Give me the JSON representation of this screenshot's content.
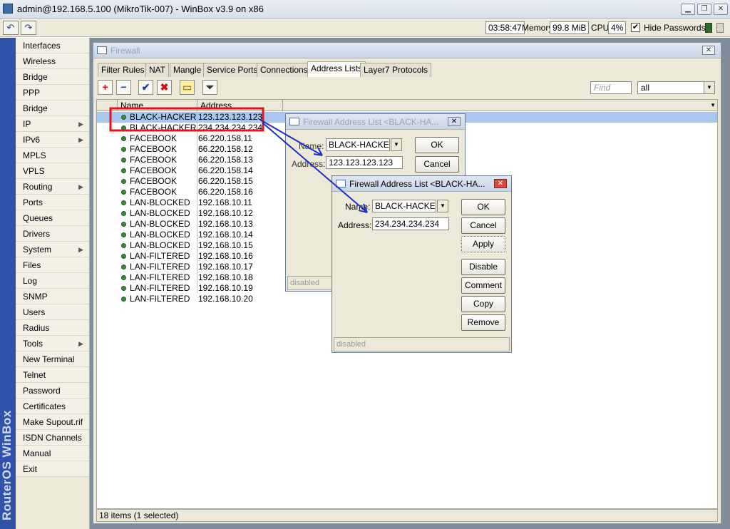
{
  "window": {
    "title": "admin@192.168.5.100 (MikroTik-007) - WinBox v3.9 on x86",
    "minimize": "▁",
    "maximize": "❐",
    "close": "✕"
  },
  "toolbar": {
    "undo": "↶",
    "redo": "↷",
    "time": "03:58:47",
    "memory_label": "Memory:",
    "memory_value": "99.8 MiB",
    "cpu_label": "CPU:",
    "cpu_value": "4%",
    "hide_passwords_label": "Hide Passwords",
    "hide_passwords_checked": "✔"
  },
  "brand": "RouterOS WinBox",
  "sidebar": {
    "items": [
      {
        "label": "Interfaces",
        "arrow": ""
      },
      {
        "label": "Wireless",
        "arrow": ""
      },
      {
        "label": "Bridge",
        "arrow": ""
      },
      {
        "label": "PPP",
        "arrow": ""
      },
      {
        "label": "Bridge",
        "arrow": ""
      },
      {
        "label": "IP",
        "arrow": "▶"
      },
      {
        "label": "IPv6",
        "arrow": "▶"
      },
      {
        "label": "MPLS",
        "arrow": ""
      },
      {
        "label": "VPLS",
        "arrow": ""
      },
      {
        "label": "Routing",
        "arrow": "▶"
      },
      {
        "label": "Ports",
        "arrow": ""
      },
      {
        "label": "Queues",
        "arrow": ""
      },
      {
        "label": "Drivers",
        "arrow": ""
      },
      {
        "label": "System",
        "arrow": "▶"
      },
      {
        "label": "Files",
        "arrow": ""
      },
      {
        "label": "Log",
        "arrow": ""
      },
      {
        "label": "SNMP",
        "arrow": ""
      },
      {
        "label": "Users",
        "arrow": ""
      },
      {
        "label": "Radius",
        "arrow": ""
      },
      {
        "label": "Tools",
        "arrow": "▶"
      },
      {
        "label": "New Terminal",
        "arrow": ""
      },
      {
        "label": "Telnet",
        "arrow": ""
      },
      {
        "label": "Password",
        "arrow": ""
      },
      {
        "label": "Certificates",
        "arrow": ""
      },
      {
        "label": "Make Supout.rif",
        "arrow": ""
      },
      {
        "label": "ISDN Channels",
        "arrow": ""
      },
      {
        "label": "Manual",
        "arrow": ""
      },
      {
        "label": "Exit",
        "arrow": ""
      }
    ]
  },
  "firewall": {
    "title": "Firewall",
    "close": "✕",
    "tabs": [
      "Filter Rules",
      "NAT",
      "Mangle",
      "Service Ports",
      "Connections",
      "Address Lists",
      "Layer7 Protocols"
    ],
    "active_tab": "Address Lists",
    "actions": {
      "add": "+",
      "remove": "−",
      "enable": "✔",
      "disable": "✖",
      "comment": "▭",
      "filter": "⏷"
    },
    "find_placeholder": "Find",
    "filter_value": "all",
    "columns": {
      "name": "Name",
      "address": "Address"
    },
    "rows": [
      {
        "name": "BLACK-HACKER",
        "address": "123.123.123.123",
        "selected": true
      },
      {
        "name": "BLACK-HACKER",
        "address": "234.234.234.234",
        "selected": false
      },
      {
        "name": "FACEBOOK",
        "address": "66.220.158.11",
        "selected": false
      },
      {
        "name": "FACEBOOK",
        "address": "66.220.158.12",
        "selected": false
      },
      {
        "name": "FACEBOOK",
        "address": "66.220.158.13",
        "selected": false
      },
      {
        "name": "FACEBOOK",
        "address": "66.220.158.14",
        "selected": false
      },
      {
        "name": "FACEBOOK",
        "address": "66.220.158.15",
        "selected": false
      },
      {
        "name": "FACEBOOK",
        "address": "66.220.158.16",
        "selected": false
      },
      {
        "name": "LAN-BLOCKED",
        "address": "192.168.10.11",
        "selected": false
      },
      {
        "name": "LAN-BLOCKED",
        "address": "192.168.10.12",
        "selected": false
      },
      {
        "name": "LAN-BLOCKED",
        "address": "192.168.10.13",
        "selected": false
      },
      {
        "name": "LAN-BLOCKED",
        "address": "192.168.10.14",
        "selected": false
      },
      {
        "name": "LAN-BLOCKED",
        "address": "192.168.10.15",
        "selected": false
      },
      {
        "name": "LAN-FILTERED",
        "address": "192.168.10.16",
        "selected": false
      },
      {
        "name": "LAN-FILTERED",
        "address": "192.168.10.17",
        "selected": false
      },
      {
        "name": "LAN-FILTERED",
        "address": "192.168.10.18",
        "selected": false
      },
      {
        "name": "LAN-FILTERED",
        "address": "192.168.10.19",
        "selected": false
      },
      {
        "name": "LAN-FILTERED",
        "address": "192.168.10.20",
        "selected": false
      }
    ],
    "status": "18 items (1 selected)"
  },
  "dialog_back": {
    "title": "Firewall Address List <BLACK-HA...",
    "close": "✕",
    "name_label": "Name:",
    "name_value": "BLACK-HACKER",
    "address_label": "Address:",
    "address_value": "123.123.123.123",
    "ok": "OK",
    "cancel": "Cancel",
    "footer": "disabled"
  },
  "dialog_front": {
    "title": "Firewall Address List <BLACK-HA...",
    "close": "✕",
    "name_label": "Name:",
    "name_value": "BLACK-HACKER",
    "address_label": "Address:",
    "address_value": "234.234.234.234",
    "ok": "OK",
    "cancel": "Cancel",
    "apply": "Apply",
    "disable": "Disable",
    "comment": "Comment",
    "copy": "Copy",
    "remove": "Remove",
    "footer": "disabled"
  },
  "colors": {
    "highlight_box": "#e0141c",
    "arrow": "#1f2fc8",
    "selection": "#a8c6ee",
    "brand_strip": "#2f53a8"
  }
}
